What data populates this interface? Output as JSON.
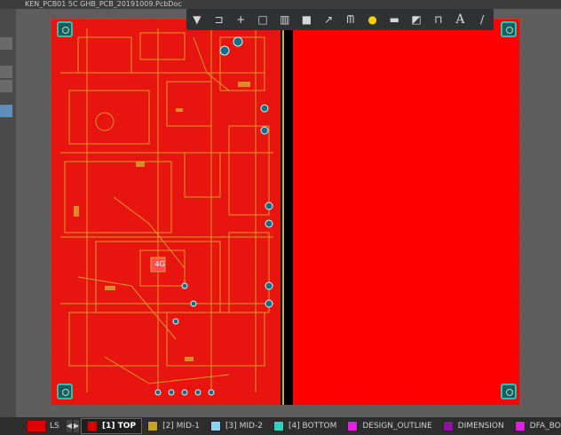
{
  "window": {
    "tab_title": "KEN_PCB01 5C GHB_PCB_20191009.PcbDoc"
  },
  "toolbar": {
    "items": [
      {
        "name": "filter-icon",
        "glyph": "▼"
      },
      {
        "name": "route-icon",
        "glyph": "⊐"
      },
      {
        "name": "cross-icon",
        "glyph": "+"
      },
      {
        "name": "select-rect-icon",
        "glyph": "□"
      },
      {
        "name": "chart-icon",
        "glyph": "▥"
      },
      {
        "name": "component-icon",
        "glyph": "■"
      },
      {
        "name": "interactive-route-icon",
        "glyph": "↗"
      },
      {
        "name": "diff-pair-icon",
        "glyph": "ᗰ"
      },
      {
        "name": "via-icon",
        "glyph": "●"
      },
      {
        "name": "fill-icon",
        "glyph": "▬"
      },
      {
        "name": "polygon-icon",
        "glyph": "◩"
      },
      {
        "name": "dimension-icon",
        "glyph": "⊓"
      },
      {
        "name": "string-icon",
        "glyph": "A"
      },
      {
        "name": "line-icon",
        "glyph": "/"
      }
    ]
  },
  "board": {
    "component_label": "4G"
  },
  "statusbar": {
    "ls_label": "LS",
    "ls_color": "#e00000",
    "layers": [
      {
        "label": "[1] TOP",
        "color": "#e00000",
        "active": true
      },
      {
        "label": "[2] MID-1",
        "color": "#c8a020",
        "active": false
      },
      {
        "label": "[3] MID-2",
        "color": "#8fd0f0",
        "active": false
      },
      {
        "label": "[4] BOTTOM",
        "color": "#30d0c0",
        "active": false
      },
      {
        "label": "DESIGN_OUTLINE",
        "color": "#e020e0",
        "active": false
      },
      {
        "label": "DIMENSION",
        "color": "#9010a0",
        "active": false
      },
      {
        "label": "DFA_BOUN",
        "color": "#e020e0",
        "active": false
      }
    ]
  }
}
